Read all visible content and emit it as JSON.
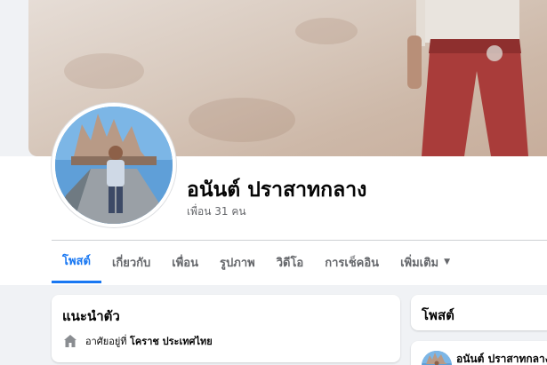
{
  "profile": {
    "name": "อนันต์ ปราสาทกลาง",
    "friends_count": "เพื่อน 31 คน"
  },
  "tabs": [
    {
      "label": "โพสต์",
      "active": true
    },
    {
      "label": "เกี่ยวกับ",
      "active": false
    },
    {
      "label": "เพื่อน",
      "active": false
    },
    {
      "label": "รูปภาพ",
      "active": false
    },
    {
      "label": "วิดีโอ",
      "active": false
    },
    {
      "label": "การเช็คอิน",
      "active": false
    },
    {
      "label": "เพิ่มเติม",
      "active": false,
      "has_dropdown": true
    }
  ],
  "intro": {
    "title": "แนะนำตัว",
    "lives_in_label": "อาศัยอยู่ที่",
    "lives_in_value": "โคราช ประเทศไทย",
    "icon": "home-icon"
  },
  "posts": {
    "title": "โพสต์",
    "author": "อนันต์ ปราสาทกลาง"
  },
  "colors": {
    "accent": "#1877f2",
    "page_background": "#f0f2f5",
    "secondary_text": "#65676b",
    "card_background": "#ffffff"
  }
}
